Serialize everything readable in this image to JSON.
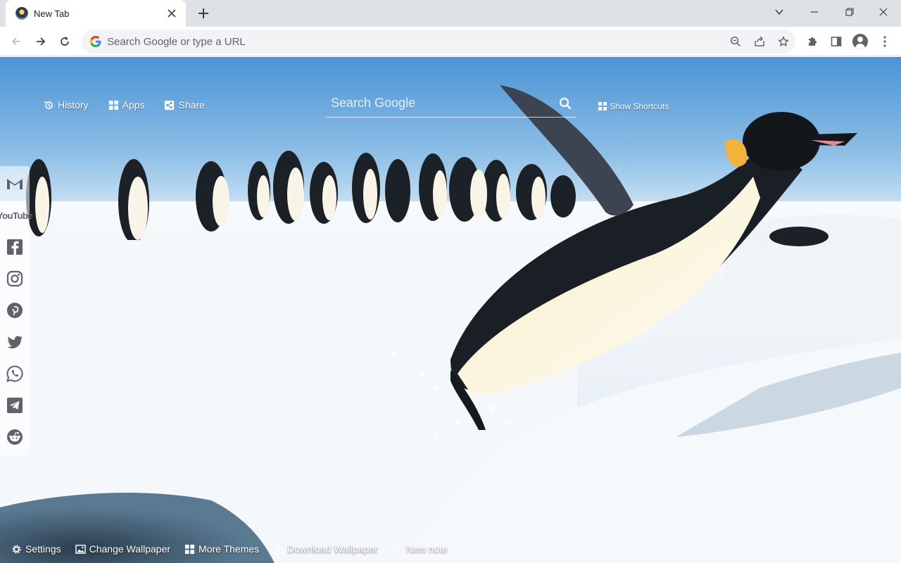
{
  "tab": {
    "title": "New Tab"
  },
  "omnibox": {
    "placeholder": "Search Google or type a URL"
  },
  "top_links": [
    {
      "label": "History",
      "icon": "history-icon"
    },
    {
      "label": "Apps",
      "icon": "apps-grid-icon"
    },
    {
      "label": "Share",
      "icon": "share-icon"
    }
  ],
  "search": {
    "placeholder": "Search Google"
  },
  "shortcuts": {
    "label": "Show Shortcuts"
  },
  "social": [
    {
      "name": "gmail",
      "icon": "gmail-icon"
    },
    {
      "name": "youtube",
      "icon": "youtube-icon",
      "label": "YouTube"
    },
    {
      "name": "facebook",
      "icon": "facebook-icon"
    },
    {
      "name": "instagram",
      "icon": "instagram-icon"
    },
    {
      "name": "pinterest",
      "icon": "pinterest-icon"
    },
    {
      "name": "twitter",
      "icon": "twitter-icon"
    },
    {
      "name": "whatsapp",
      "icon": "whatsapp-icon"
    },
    {
      "name": "telegram",
      "icon": "telegram-icon"
    },
    {
      "name": "reddit",
      "icon": "reddit-icon"
    }
  ],
  "bottom_links": [
    {
      "label": "Settings",
      "icon": "gear-icon"
    },
    {
      "label": "Change Wallpaper",
      "icon": "image-icon"
    },
    {
      "label": "More Themes",
      "icon": "grid-icon"
    },
    {
      "label": "Download Wallpaper",
      "icon": "download-icon"
    },
    {
      "label": "New note",
      "icon": "plus-icon"
    }
  ],
  "colors": {
    "tabstrip": "#dee1e6",
    "sky": "#5a9ed8",
    "snow": "#eef4f8"
  }
}
